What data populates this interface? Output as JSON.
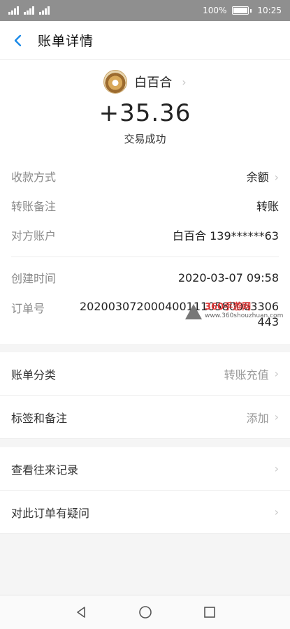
{
  "status_bar": {
    "battery_text": "100%",
    "time": "10:25"
  },
  "header": {
    "title": "账单详情"
  },
  "payer": {
    "name": "白百合"
  },
  "amount": "+35.36",
  "status_text": "交易成功",
  "details": [
    {
      "label": "收款方式",
      "value": "余额"
    },
    {
      "label": "转账备注",
      "value": "转账"
    },
    {
      "label": "对方账户",
      "value": "白百合 139******63"
    },
    {
      "label": "创建时间",
      "value": "2020-03-07 09:58"
    }
  ],
  "order": {
    "label": "订单号",
    "value": "2020030720004001110580063306443"
  },
  "watermark": {
    "main": "360手游网",
    "sub": "www.360shouzhuan.com"
  },
  "list1": [
    {
      "label": "账单分类",
      "value": "转账充值"
    },
    {
      "label": "标签和备注",
      "value": "添加"
    }
  ],
  "list2": [
    {
      "label": "查看往来记录"
    },
    {
      "label": "对此订单有疑问"
    }
  ],
  "icons": {
    "back": "back-arrow-icon",
    "chevron": "chevron-right-icon",
    "nav_back": "triangle-back-icon",
    "nav_home": "circle-home-icon",
    "nav_recent": "square-recent-icon"
  }
}
